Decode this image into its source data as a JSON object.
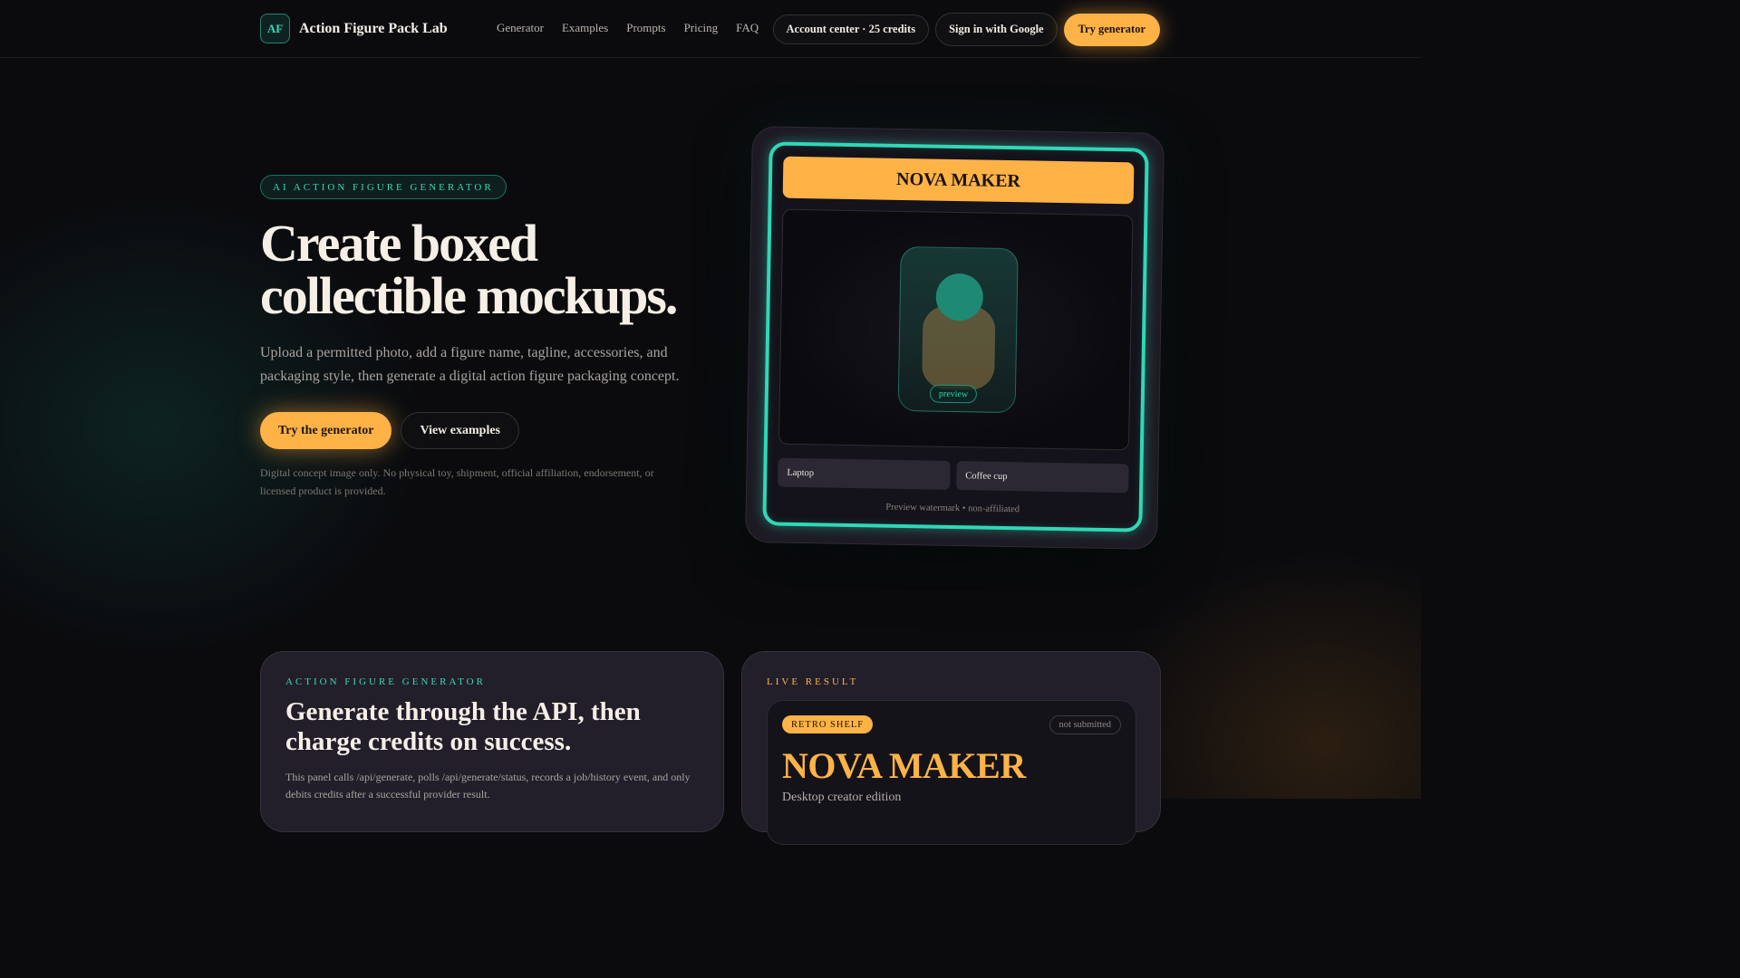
{
  "header": {
    "brand_logo": "AF",
    "brand_name": "Action Figure Pack Lab",
    "nav": [
      "Generator",
      "Examples",
      "Prompts",
      "Pricing",
      "FAQ"
    ],
    "account_label": "Account center · 25 credits",
    "signin_label": "Sign in with Google",
    "try_label": "Try generator"
  },
  "hero": {
    "eyebrow": "AI ACTION FIGURE GENERATOR",
    "title_line1": "Create boxed",
    "title_line2": "collectible mockups.",
    "subtitle": "Upload a permitted photo, add a figure name, tagline, accessories, and packaging style, then generate a digital action figure packaging concept.",
    "cta_primary": "Try the generator",
    "cta_secondary": "View examples",
    "note": "Digital concept image only. No physical toy, shipment, official affiliation, endorsement, or licensed product is provided."
  },
  "mockup": {
    "banner": "NOVA MAKER",
    "preview_tag": "preview",
    "accessories": [
      "Laptop",
      "Coffee cup"
    ],
    "footer": "Preview watermark • non-affiliated"
  },
  "generator_card": {
    "eyebrow": "ACTION FIGURE GENERATOR",
    "title": "Generate through the API, then charge credits on success.",
    "text": "This panel calls /api/generate, polls /api/generate/status, records a job/history event, and only debits credits after a successful provider result."
  },
  "result_card": {
    "eyebrow": "LIVE RESULT",
    "style_badge": "RETRO SHELF",
    "status": "not submitted",
    "name": "NOVA MAKER",
    "subtitle": "Desktop creator edition"
  },
  "colors": {
    "accent_amber": "#ffb347",
    "accent_teal": "#2fd8b6",
    "background": "#0b0b0e",
    "card": "#221e2a"
  }
}
